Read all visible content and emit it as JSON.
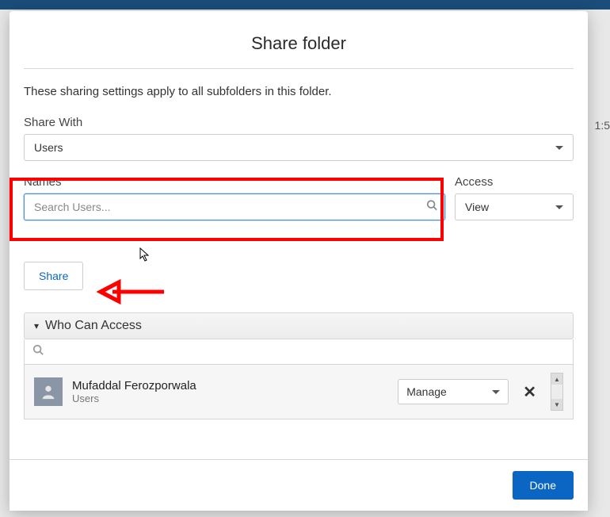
{
  "modal": {
    "title": "Share folder",
    "subtext": "These sharing settings apply to all subfolders in this folder.",
    "share_with": {
      "label": "Share With",
      "value": "Users"
    },
    "names": {
      "label": "Names",
      "placeholder": "Search Users..."
    },
    "access": {
      "label": "Access",
      "value": "View"
    },
    "share_button": "Share",
    "who_can_access": {
      "title": "Who Can Access",
      "members": [
        {
          "name": "Mufaddal Ferozporwala",
          "type": "Users",
          "permission": "Manage"
        }
      ]
    },
    "done_button": "Done"
  },
  "background": {
    "side_value": "1:5"
  }
}
